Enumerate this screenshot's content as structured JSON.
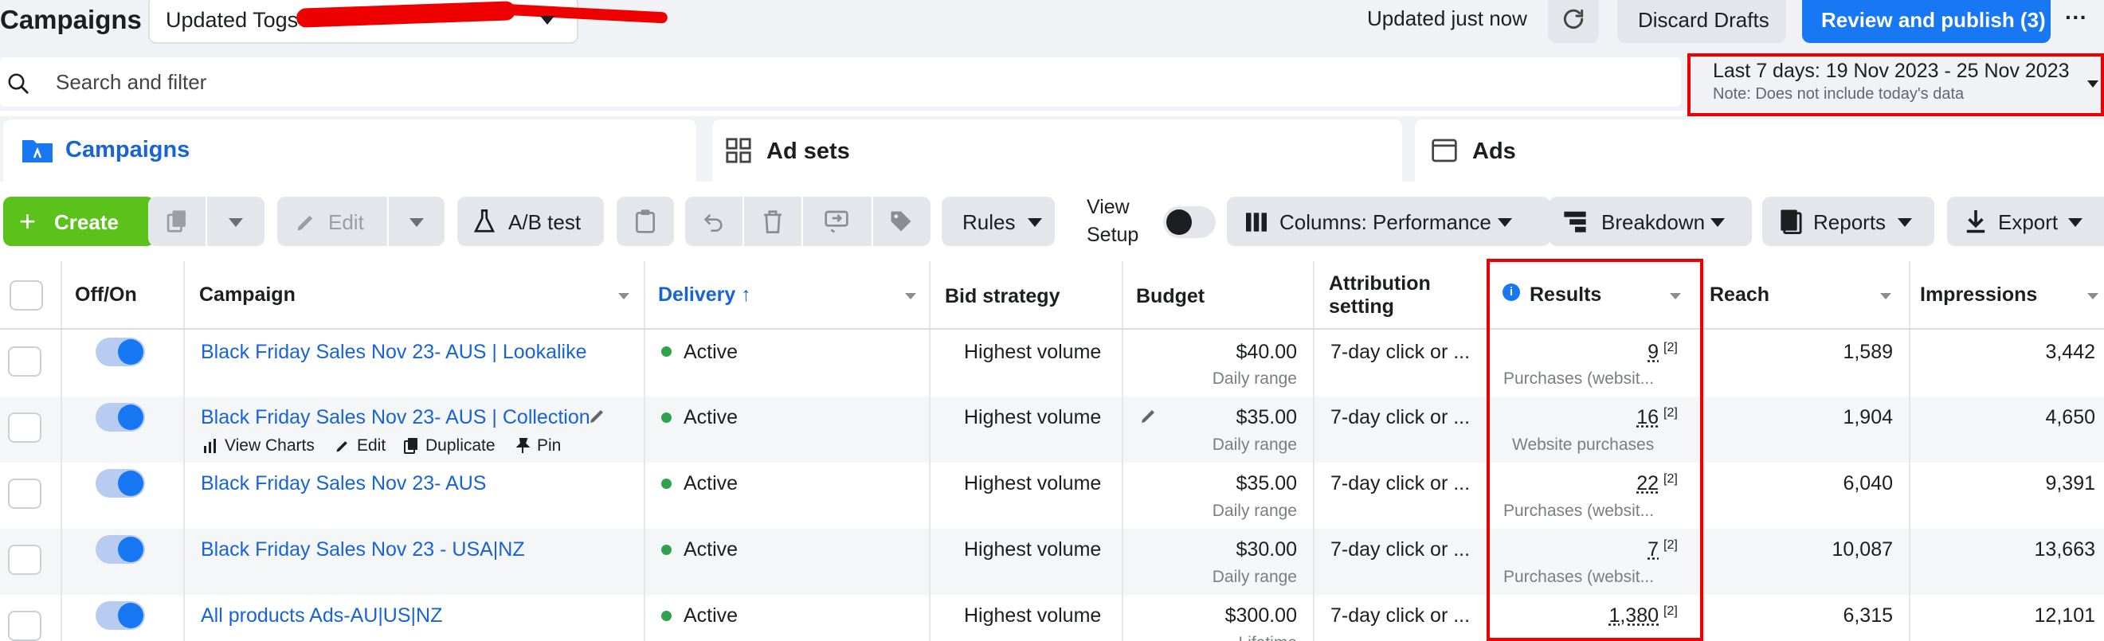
{
  "header": {
    "title": "Campaigns",
    "draft_name": "Updated Togs",
    "status": "Updated just now",
    "discard_label": "Discard Drafts",
    "publish_label": "Review and publish (3)",
    "more_label": "···"
  },
  "search": {
    "placeholder": "Search and filter"
  },
  "date_range": {
    "label": "Last 7 days: 19 Nov 2023 - 25 Nov 2023",
    "note": "Note: Does not include today's data"
  },
  "tabs": [
    {
      "label": "Campaigns",
      "active": true
    },
    {
      "label": "Ad sets",
      "active": false
    },
    {
      "label": "Ads",
      "active": false
    }
  ],
  "toolbar": {
    "create": "Create",
    "edit": "Edit",
    "ab_test": "A/B test",
    "rules": "Rules",
    "view_setup": "View\nSetup",
    "columns": "Columns: Performance",
    "breakdown": "Breakdown",
    "reports": "Reports",
    "export": "Export"
  },
  "columns": {
    "off_on": "Off/On",
    "campaign": "Campaign",
    "delivery": "Delivery ↑",
    "bid_strategy": "Bid strategy",
    "budget": "Budget",
    "attribution": "Attribution\nsetting",
    "results": "Results",
    "reach": "Reach",
    "impressions": "Impressions"
  },
  "row_actions": {
    "view_charts": "View Charts",
    "edit": "Edit",
    "duplicate": "Duplicate",
    "pin": "Pin"
  },
  "rows": [
    {
      "name": "Black Friday Sales Nov 23- AUS | Lookalike",
      "delivery": "Active",
      "bid": "Highest volume",
      "budget": "$40.00",
      "budget_type": "Daily range",
      "attribution": "7-day click or ...",
      "result": "9",
      "footnote": "[2]",
      "result_type": "Purchases (websit...",
      "reach": "1,589",
      "impressions": "3,442"
    },
    {
      "name": "Black Friday Sales Nov 23- AUS | Collection",
      "delivery": "Active",
      "bid": "Highest volume",
      "budget": "$35.00",
      "budget_type": "Daily range",
      "attribution": "7-day click or ...",
      "result": "16",
      "footnote": "[2]",
      "result_type": "Website purchases",
      "reach": "1,904",
      "impressions": "4,650"
    },
    {
      "name": "Black Friday Sales Nov 23- AUS",
      "delivery": "Active",
      "bid": "Highest volume",
      "budget": "$35.00",
      "budget_type": "Daily range",
      "attribution": "7-day click or ...",
      "result": "22",
      "footnote": "[2]",
      "result_type": "Purchases (websit...",
      "reach": "6,040",
      "impressions": "9,391"
    },
    {
      "name": "Black Friday Sales Nov 23 - USA|NZ",
      "delivery": "Active",
      "bid": "Highest volume",
      "budget": "$30.00",
      "budget_type": "Daily range",
      "attribution": "7-day click or ...",
      "result": "7",
      "footnote": "[2]",
      "result_type": "Purchases (websit...",
      "reach": "10,087",
      "impressions": "13,663"
    },
    {
      "name": "All products Ads-AU|US|NZ",
      "delivery": "Active",
      "bid": "Highest volume",
      "budget": "$300.00",
      "budget_type": "Lifetime",
      "attribution": "7-day click or ...",
      "result": "1,380",
      "footnote": "[2]",
      "result_type": "",
      "reach": "6,315",
      "impressions": "12,101"
    }
  ],
  "colors": {
    "accent": "#1877f2",
    "create": "#5ac21a",
    "highlight": "#ee0000",
    "active_dot": "#31a24c"
  }
}
